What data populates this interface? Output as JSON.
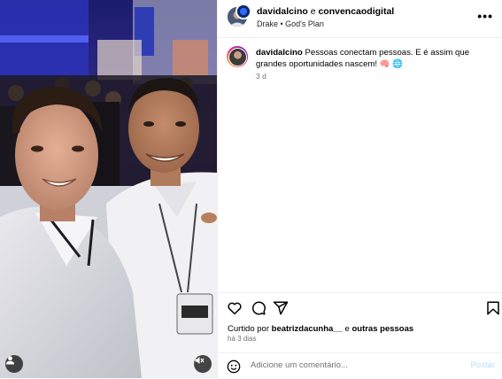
{
  "header": {
    "author": "davidalcino",
    "conjunction": "e",
    "collaborator": "convencaodigital",
    "music": "Drake • God's Plan",
    "more_icon": "more-horizontal-icon"
  },
  "caption": {
    "username": "davidalcino",
    "text": "Pessoas conectam pessoas. E é assim que grandes oportunidades nascem! 🧠 🌐",
    "time": "3 d"
  },
  "actions": {
    "icons": [
      "heart-icon",
      "comment-icon",
      "share-icon",
      "bookmark-icon"
    ]
  },
  "likes": {
    "prefix": "Curtido por",
    "user": "beatrizdacunha__",
    "middle": "e",
    "others": "outras pessoas"
  },
  "post_time": "há 3 dias",
  "comment": {
    "placeholder": "Adicione um comentário...",
    "post_label": "Postar"
  },
  "photo": {
    "icons": [
      "user-tag-icon",
      "mute-icon"
    ]
  },
  "colors": {
    "link_blue": "#0095f6",
    "post_button_disabled": "#b2dffc",
    "secondary_text": "#737373",
    "divider": "#efefef"
  }
}
